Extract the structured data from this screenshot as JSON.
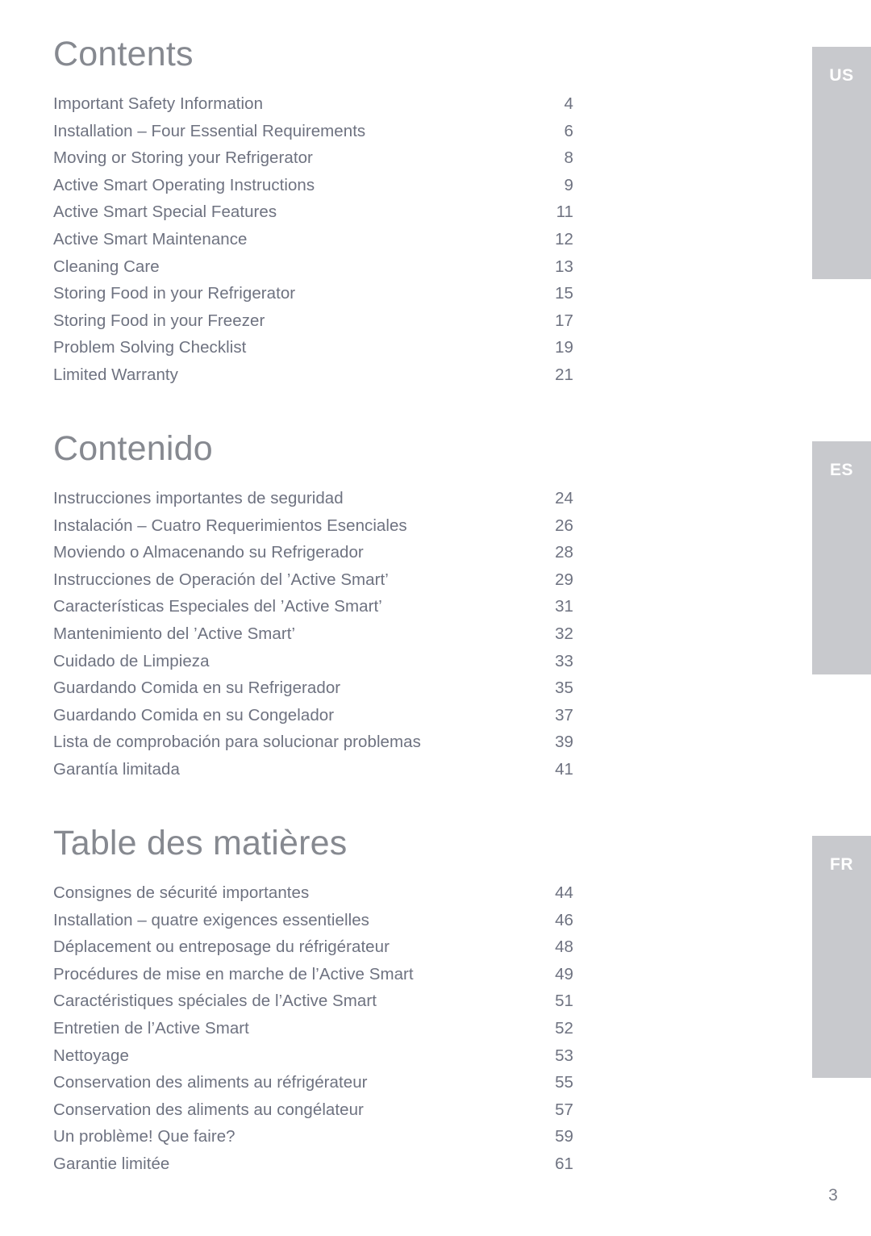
{
  "page": {
    "number": "3"
  },
  "language_tabs": [
    {
      "code": "US"
    },
    {
      "code": "ES"
    },
    {
      "code": "FR"
    }
  ],
  "sections": [
    {
      "id": "us",
      "title": "Contents",
      "entries": [
        {
          "label": "Important Safety Information",
          "page": "4"
        },
        {
          "label": "Installation – Four Essential Requirements",
          "page": "6"
        },
        {
          "label": "Moving or Storing your Refrigerator",
          "page": "8"
        },
        {
          "label": "Active Smart Operating Instructions",
          "page": "9"
        },
        {
          "label": "Active Smart Special Features",
          "page": "11"
        },
        {
          "label": "Active Smart Maintenance",
          "page": "12"
        },
        {
          "label": "Cleaning Care",
          "page": "13"
        },
        {
          "label": "Storing Food in your Refrigerator",
          "page": "15"
        },
        {
          "label": "Storing Food in your Freezer",
          "page": "17"
        },
        {
          "label": "Problem Solving Checklist",
          "page": "19"
        },
        {
          "label": "Limited Warranty",
          "page": "21"
        }
      ]
    },
    {
      "id": "es",
      "title": "Contenido",
      "entries": [
        {
          "label": "Instrucciones importantes de seguridad",
          "page": "24"
        },
        {
          "label": "Instalación – Cuatro Requerimientos Esenciales",
          "page": "26"
        },
        {
          "label": "Moviendo o Almacenando su Refrigerador",
          "page": "28"
        },
        {
          "label": "Instrucciones de Operación del ’Active Smart’",
          "page": "29"
        },
        {
          "label": "Características Especiales del ’Active Smart’",
          "page": "31"
        },
        {
          "label": "Mantenimiento del ’Active Smart’",
          "page": "32"
        },
        {
          "label": "Cuidado de Limpieza",
          "page": "33"
        },
        {
          "label": "Guardando Comida en su Refrigerador",
          "page": "35"
        },
        {
          "label": "Guardando Comida en su Congelador",
          "page": "37"
        },
        {
          "label": "Lista de comprobación para solucionar problemas",
          "page": "39"
        },
        {
          "label": "Garantía limitada",
          "page": "41"
        }
      ]
    },
    {
      "id": "fr",
      "title": "Table des matières",
      "entries": [
        {
          "label": "Consignes de sécurité importantes",
          "page": "44"
        },
        {
          "label": "Installation – quatre exigences essentielles",
          "page": "46"
        },
        {
          "label": "Déplacement ou entreposage du réfrigérateur",
          "page": "48"
        },
        {
          "label": "Procédures de mise en marche de l’Active Smart",
          "page": "49"
        },
        {
          "label": "Caractéristiques spéciales de l’Active Smart",
          "page": "51"
        },
        {
          "label": "Entretien de l’Active Smart",
          "page": "52"
        },
        {
          "label": "Nettoyage",
          "page": "53"
        },
        {
          "label": "Conservation des aliments au réfrigérateur",
          "page": "55"
        },
        {
          "label": "Conservation des aliments au congélateur",
          "page": "57"
        },
        {
          "label": "Un problème! Que faire?",
          "page": "59"
        },
        {
          "label": "Garantie limitée",
          "page": "61"
        }
      ]
    }
  ],
  "colors": {
    "tab_background": "#c8c9cd",
    "tab_text": "#ffffff",
    "heading_text": "#868990",
    "entry_text": "#6e7280",
    "page_background": "#ffffff"
  }
}
